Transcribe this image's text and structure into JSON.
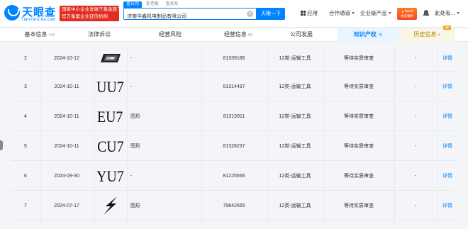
{
  "header": {
    "logo": {
      "name": "天眼查",
      "domain": "TianYanCha.com"
    },
    "banner": [
      "国家中小企业发展子基金旗下",
      "官方备案企业征信机构"
    ],
    "search_tabs": [
      "查公司",
      "查老板",
      "查关系"
    ],
    "search": {
      "value": "济南华鑫机电制品有限公司",
      "button": "天眼一下"
    },
    "nav": {
      "apps": "应用",
      "cooperation": "合作通道",
      "enterprise": "企业级产品"
    },
    "vip_badge": [
      "🔥38VIP",
      "会员福利"
    ],
    "user": "此处有..."
  },
  "tabs": [
    {
      "label": "基本信息",
      "count": "120"
    },
    {
      "label": "法律诉讼",
      "count": ""
    },
    {
      "label": "经营风险",
      "count": ""
    },
    {
      "label": "经营信息",
      "count": "58"
    },
    {
      "label": "公司发展",
      "count": ""
    },
    {
      "label": "知识产权",
      "count": "75"
    },
    {
      "label": "历史信息",
      "count": "4",
      "tag": "VIP"
    }
  ],
  "rows": [
    {
      "index": "2",
      "date": "2024-10-12",
      "mark_type": "logo",
      "mark_text": "",
      "name": "-",
      "reg_no": "81339186",
      "class": "12类-运输工具",
      "status": "等待实质审查",
      "pub": "-",
      "detail": "详情"
    },
    {
      "index": "3",
      "date": "2024-10-11",
      "mark_type": "text",
      "mark_text": "UU7",
      "name": "-",
      "reg_no": "81314497",
      "class": "12类-运输工具",
      "status": "等待实质审查",
      "pub": "-",
      "detail": "详情"
    },
    {
      "index": "4",
      "date": "2024-10-11",
      "mark_type": "text",
      "mark_text": "EU7",
      "name": "图形",
      "reg_no": "81315911",
      "class": "12类-运输工具",
      "status": "等待实质审查",
      "pub": "-",
      "detail": "详情"
    },
    {
      "index": "5",
      "date": "2024-10-11",
      "mark_type": "text",
      "mark_text": "CU7",
      "name": "图形",
      "reg_no": "81328237",
      "class": "12类-运输工具",
      "status": "等待实质审查",
      "pub": "-",
      "detail": "详情"
    },
    {
      "index": "6",
      "date": "2024-09-30",
      "mark_type": "text",
      "mark_text": "YU7",
      "name": "-",
      "reg_no": "81225556",
      "class": "12类-运输工具",
      "status": "等待实质审查",
      "pub": "-",
      "detail": "详情"
    },
    {
      "index": "7",
      "date": "2024-07-17",
      "mark_type": "bolt",
      "mark_text": "",
      "name": "图形",
      "reg_no": "79842665",
      "class": "12类-运输工具",
      "status": "等待实质审查",
      "pub": "-",
      "detail": "详情"
    }
  ],
  "colors": {
    "accent": "#0084ff",
    "banner": "#e12c1f",
    "vip": "#f5a623"
  }
}
